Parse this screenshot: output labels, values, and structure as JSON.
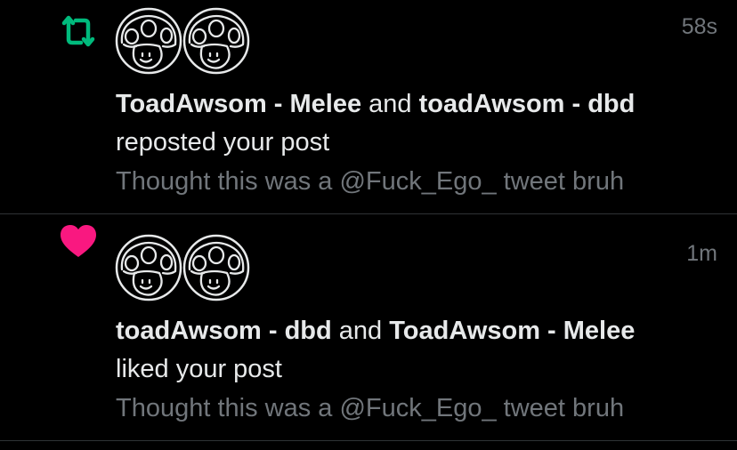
{
  "colors": {
    "background": "#000000",
    "primary_text": "#e7e9ea",
    "secondary_text": "#71767b",
    "repost_green": "#00ba7c",
    "like_pink": "#f91880",
    "divider": "#2f3336"
  },
  "notifications": [
    {
      "type": "repost",
      "icon": "repost-icon",
      "avatars": [
        "toad-avatar",
        "toad-avatar"
      ],
      "timestamp": "58s",
      "user1": "ToadAwsom - Melee",
      "joiner": "and",
      "user2": "toadAwsom - dbd",
      "action": "reposted your post",
      "preview": "Thought this was a @Fuck_Ego_ tweet bruh"
    },
    {
      "type": "like",
      "icon": "heart-icon",
      "avatars": [
        "toad-avatar",
        "toad-avatar"
      ],
      "timestamp": "1m",
      "user1": "toadAwsom - dbd",
      "joiner": "and",
      "user2": "ToadAwsom - Melee",
      "action": "liked your post",
      "preview": "Thought this was a @Fuck_Ego_ tweet bruh"
    }
  ]
}
